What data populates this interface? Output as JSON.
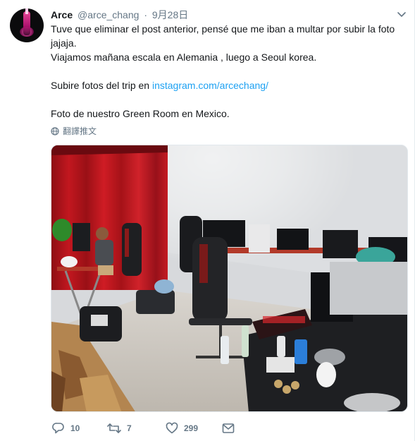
{
  "tweet": {
    "name": "Arce",
    "handle": "@arce_chang",
    "separator": "·",
    "date": "9月28日",
    "text": {
      "line1": "Tuve que eliminar el post anterior, pensé que me iban a multar por subir la foto",
      "line2": "jajaja.",
      "line3": "Viajamos mañana escala en Alemania , luego a Seoul korea.",
      "line4_prefix": "Subire fotos del trip en ",
      "link": "instagram.com/arcechang/",
      "line5": "Foto de nuestro Green Room en Mexico."
    },
    "translate_label": "翻譯推文",
    "counts": {
      "replies": "10",
      "retweets": "7",
      "likes": "299"
    }
  },
  "icons": {
    "caret": "chevron-down-icon",
    "globe": "globe-icon",
    "reply": "reply-icon",
    "retweet": "retweet-icon",
    "like": "heart-icon",
    "dm": "envelope-icon"
  },
  "colors": {
    "text": "#14171a",
    "muted": "#657786",
    "link": "#1da1f2",
    "border": "#e6ecf0"
  }
}
